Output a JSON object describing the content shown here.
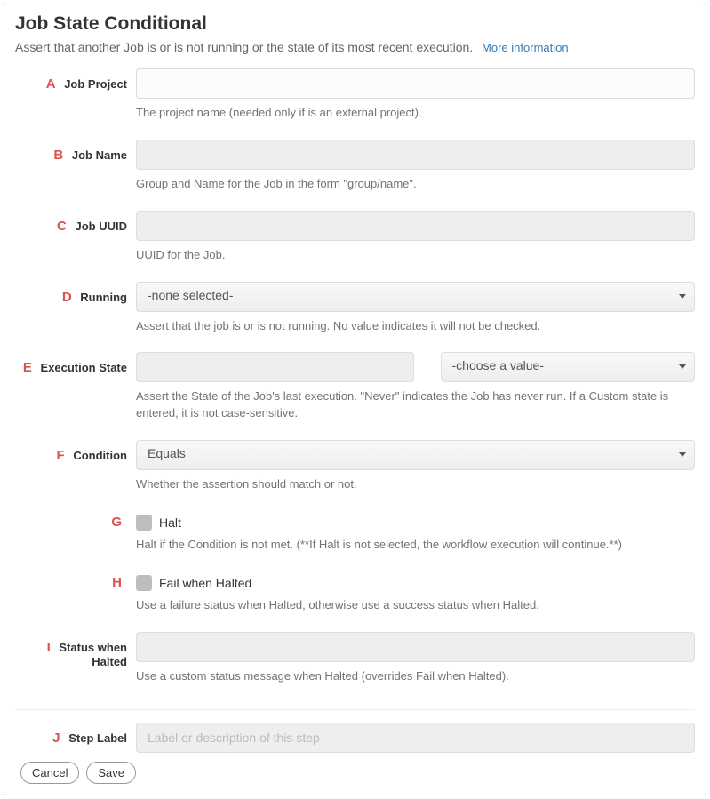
{
  "panel": {
    "title": "Job State Conditional",
    "subtitle": "Assert that another Job is or is not running or the state of its most recent execution.",
    "more_info": "More information"
  },
  "fields": {
    "job_project": {
      "letter": "A",
      "label": "Job Project",
      "value": "",
      "help": "The project name (needed only if is an external project)."
    },
    "job_name": {
      "letter": "B",
      "label": "Job Name",
      "value": "",
      "help": "Group and Name for the Job in the form \"group/name\"."
    },
    "job_uuid": {
      "letter": "C",
      "label": "Job UUID",
      "value": "",
      "help": "UUID for the Job."
    },
    "running": {
      "letter": "D",
      "label": "Running",
      "value": "-none selected-",
      "help": "Assert that the job is or is not running. No value indicates it will not be checked."
    },
    "exec_state": {
      "letter": "E",
      "label": "Execution State",
      "text_value": "",
      "select_value": "-choose a value-",
      "help": "Assert the State of the Job's last execution. \"Never\" indicates the Job has never run. If a Custom state is entered, it is not case-sensitive."
    },
    "condition": {
      "letter": "F",
      "label": "Condition",
      "value": "Equals",
      "help": "Whether the assertion should match or not."
    },
    "halt": {
      "letter": "G",
      "label": "Halt",
      "help": "Halt if the Condition is not met. (**If Halt is not selected, the workflow execution will continue.**)"
    },
    "fail_halted": {
      "letter": "H",
      "label": "Fail when Halted",
      "help": "Use a failure status when Halted, otherwise use a success status when Halted."
    },
    "status_halted": {
      "letter": "I",
      "label": "Status when Halted",
      "value": "",
      "help": "Use a custom status message when Halted (overrides Fail when Halted)."
    },
    "step_label": {
      "letter": "J",
      "label": "Step Label",
      "placeholder": "Label or description of this step"
    }
  },
  "buttons": {
    "cancel": "Cancel",
    "save": "Save"
  }
}
